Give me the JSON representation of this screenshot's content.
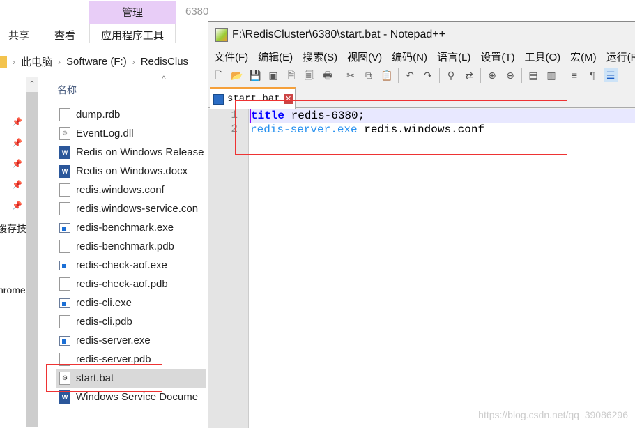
{
  "explorer": {
    "ribbon": {
      "context_label": "管理",
      "context_tab": "应用程序工具",
      "tabs": [
        "共享",
        "查看"
      ],
      "folder_title": "6380"
    },
    "address": [
      "此电脑",
      "Software (F:)",
      "RedisClus"
    ],
    "column_header": "名称",
    "nav_partial": [
      "缓存技",
      "hrome"
    ],
    "files": [
      {
        "name": "dump.rdb",
        "icon": "file"
      },
      {
        "name": "EventLog.dll",
        "icon": "dll"
      },
      {
        "name": "Redis on Windows Release",
        "icon": "word"
      },
      {
        "name": "Redis on Windows.docx",
        "icon": "word"
      },
      {
        "name": "redis.windows.conf",
        "icon": "file"
      },
      {
        "name": "redis.windows-service.con",
        "icon": "file"
      },
      {
        "name": "redis-benchmark.exe",
        "icon": "exe"
      },
      {
        "name": "redis-benchmark.pdb",
        "icon": "file"
      },
      {
        "name": "redis-check-aof.exe",
        "icon": "exe"
      },
      {
        "name": "redis-check-aof.pdb",
        "icon": "file"
      },
      {
        "name": "redis-cli.exe",
        "icon": "exe"
      },
      {
        "name": "redis-cli.pdb",
        "icon": "file"
      },
      {
        "name": "redis-server.exe",
        "icon": "exe"
      },
      {
        "name": "redis-server.pdb",
        "icon": "file"
      },
      {
        "name": "start.bat",
        "icon": "bat",
        "selected": true
      },
      {
        "name": "Windows Service Docume",
        "icon": "word"
      }
    ]
  },
  "notepad": {
    "title": "F:\\RedisCluster\\6380\\start.bat - Notepad++",
    "menu": [
      "文件(F)",
      "编辑(E)",
      "搜索(S)",
      "视图(V)",
      "编码(N)",
      "语言(L)",
      "设置(T)",
      "工具(O)",
      "宏(M)",
      "运行(R)"
    ],
    "tab": "start.bat",
    "lines": [
      {
        "num": "1",
        "kw": "title",
        "rest": " redis-6380;"
      },
      {
        "num": "2",
        "kw": "redis-server.exe",
        "rest": " redis.windows.conf"
      }
    ]
  },
  "watermark": "https://blog.csdn.net/qq_39086296"
}
